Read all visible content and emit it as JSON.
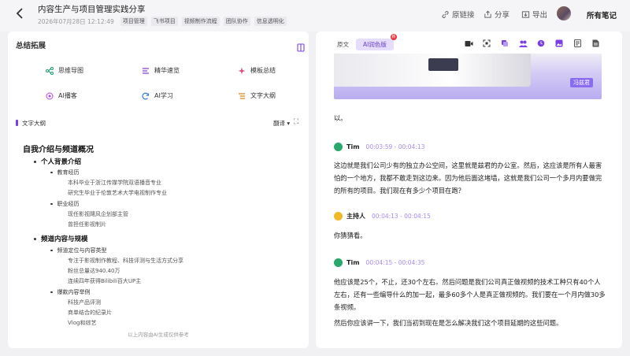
{
  "header": {
    "title": "内容生产与项目管理实践分享",
    "date": "2026年07月28日 12:12:49",
    "tags": [
      "项目管理",
      "飞书项目",
      "视频制作流程",
      "团队协作",
      "信息透明化"
    ],
    "actions": {
      "source": "原链接",
      "share": "分享",
      "export": "导出",
      "all_notes": "所有笔记"
    }
  },
  "left": {
    "title": "总结拓展",
    "tools": [
      "思维导图",
      "精华速览",
      "模板总结",
      "AI播客",
      "AI学习",
      "文字大纲"
    ],
    "outline_label": "文字大纲",
    "translate": "翻译",
    "outline": {
      "h1": "自我介绍与频道概况",
      "s1": "个人背景介绍",
      "s1_a": "教育经历",
      "s1_a1": "本科毕业于浙江传媒学院双语播音专业",
      "s1_a2": "研究生毕业于伦敦艺术大学电视制作专业",
      "s1_b": "职业经历",
      "s1_b1": "现任影视飓风企划部主管",
      "s1_b2": "曾担任影视制片",
      "s2": "频道内容与规模",
      "s2_a": "频道定位与内容类型",
      "s2_a1": "专注于影视制作教程、科技评测与生活方式分享",
      "s2_a2": "粉丝总量达940.40万",
      "s2_a3": "连续四年获得Bilibili百大UP主",
      "s2_b": "爆款内容举例",
      "s2_b1": "科技产品评测",
      "s2_b2": "商单结合的纪录片",
      "s2_b3": "Vlog和综艺"
    },
    "footer": "以上内容由AI生成仅供参考"
  },
  "right": {
    "tabs": {
      "original": "原文",
      "ai": "AI润色版",
      "badge": "新"
    },
    "banner_name": "冯兹君",
    "p0": "以。",
    "seg1": {
      "speaker": "Tim",
      "time": "00:03:59 - 00:04:13",
      "text": "这边就是我们公司少有的独立办公空间，这里就是兹君的办公室。然后，这应该是所有人最害怕的一个地方，我都不敢走到这边来。因为他后面这堵墙，这就是我们公司一个多月内要做完的所有的项目。我们现在有多少个项目在跑？"
    },
    "seg2": {
      "speaker": "主持人",
      "time": "00:04:13 - 00:04:15",
      "text": "你猜猜看。"
    },
    "seg3": {
      "speaker": "Tim",
      "time": "00:04:15 - 00:04:35",
      "text": "他应该是25个，不止，还30个左右。然后问题是我们公司真正做视频的技术工种只有40个人左右，还有一些编导什么的加一起，最多60多个人是真正做视频的。我们要在一个月内做30多条视频。",
      "text2": "然后你应该讲一下，我们当初到现在是怎么解决我们这个项目延期的这些问题。"
    },
    "accent": "#7b3fe4"
  }
}
